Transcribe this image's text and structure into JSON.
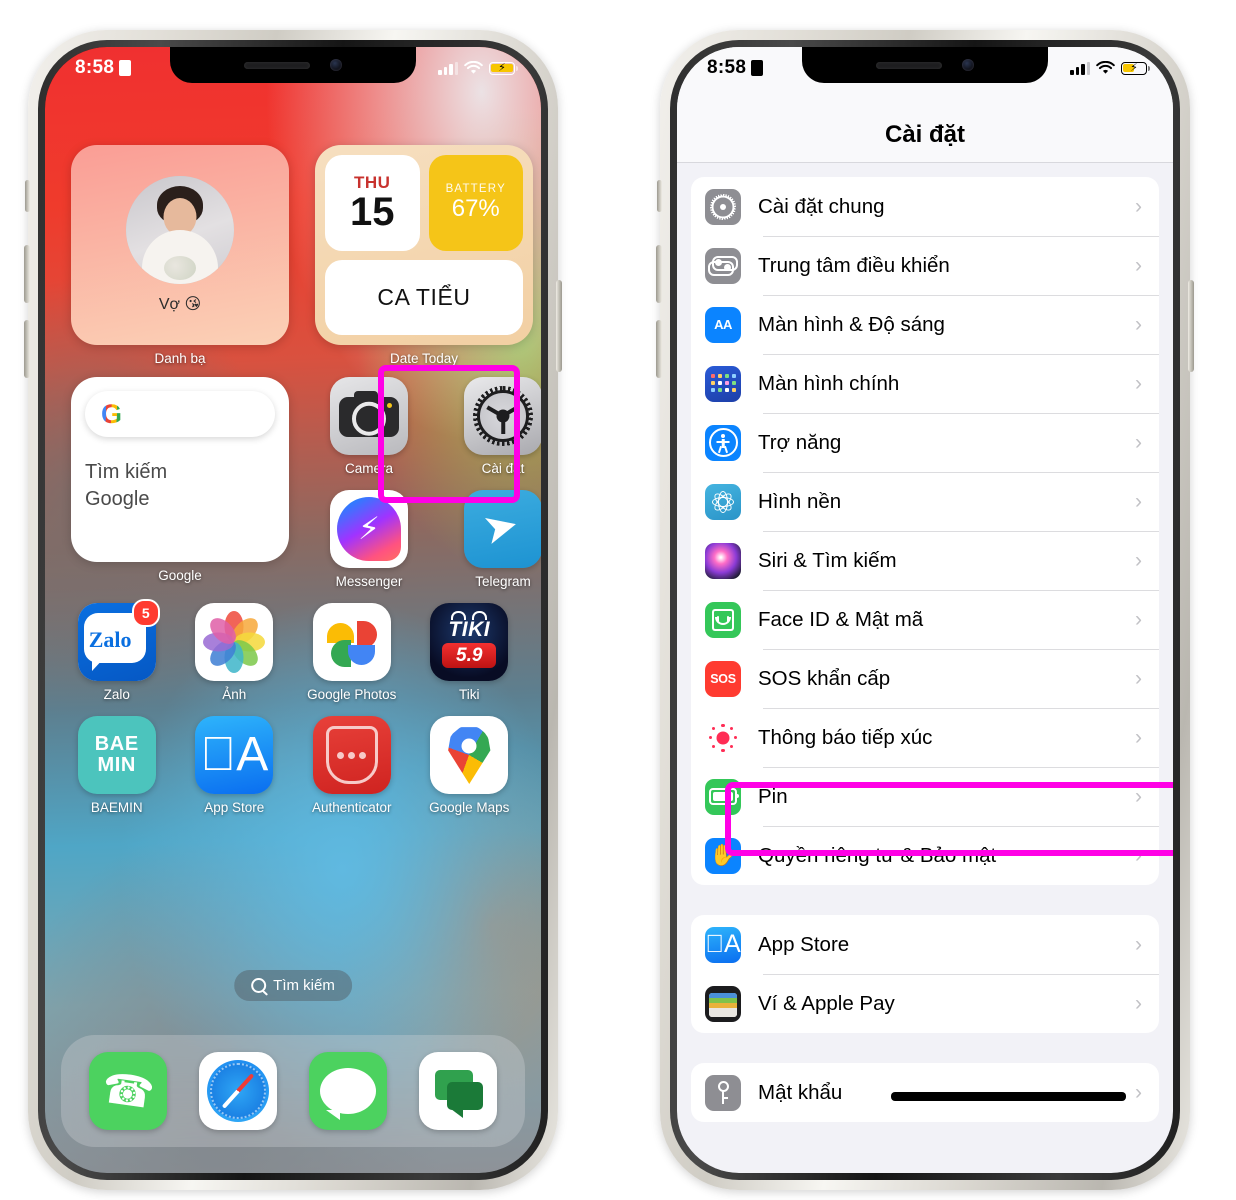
{
  "left_phone": {
    "status_bar": {
      "time": "8:58",
      "lock_icon": "orientation-lock-icon",
      "signal": "signal-bars-icon",
      "wifi": "wifi-icon",
      "battery": "battery-charging-icon"
    },
    "widgets": [
      {
        "name": "Danh bạ",
        "type": "contacts",
        "contact_name": "Vợ 😘"
      },
      {
        "name": "Date Today",
        "type": "date",
        "day_of_week": "THU",
        "day_number": "15",
        "battery_label": "BATTERY",
        "battery_value": "67%",
        "shift": "CA TIỂU"
      }
    ],
    "google_widget": {
      "label": "Google",
      "search_text": "Tìm kiếm\nGoogle",
      "line1": "Tìm kiếm",
      "line2": "Google"
    },
    "apps_row1": [
      {
        "label": "Camera",
        "icon": "camera-icon"
      },
      {
        "label": "Cài đặt",
        "icon": "settings-gear-icon",
        "highlighted": true
      }
    ],
    "apps_row2": [
      {
        "label": "Messenger",
        "icon": "messenger-icon"
      },
      {
        "label": "Telegram",
        "icon": "telegram-icon"
      }
    ],
    "apps_row3": [
      {
        "label": "Zalo",
        "icon": "zalo-icon",
        "badge": "5"
      },
      {
        "label": "Ảnh",
        "icon": "photos-icon"
      },
      {
        "label": "Google Photos",
        "icon": "google-photos-icon"
      },
      {
        "label": "Tiki",
        "icon": "tiki-icon",
        "brand": "TIKI",
        "promo": "5.9"
      }
    ],
    "apps_row4": [
      {
        "label": "BAEMIN",
        "icon": "baemin-icon",
        "line1": "BAE",
        "line2": "MIN"
      },
      {
        "label": "App Store",
        "icon": "app-store-icon"
      },
      {
        "label": "Authenticator",
        "icon": "authenticator-icon"
      },
      {
        "label": "Google Maps",
        "icon": "google-maps-icon"
      }
    ],
    "search_pill": {
      "label": "Tìm kiếm",
      "icon": "search-icon"
    },
    "dock": [
      {
        "label": "Phone",
        "icon": "phone-icon"
      },
      {
        "label": "Safari",
        "icon": "safari-icon"
      },
      {
        "label": "Messages",
        "icon": "messages-icon"
      },
      {
        "label": "Google Messages",
        "icon": "google-messages-icon"
      }
    ]
  },
  "right_phone": {
    "status_bar": {
      "time": "8:58",
      "lock_icon": "orientation-lock-icon",
      "signal": "signal-bars-icon",
      "wifi": "wifi-icon",
      "battery": "battery-charging-icon"
    },
    "nav_title": "Cài đặt",
    "groups": [
      {
        "rows": [
          {
            "label": "Cài đặt chung",
            "icon": "general-gear-icon"
          },
          {
            "label": "Trung tâm điều khiển",
            "icon": "control-center-icon"
          },
          {
            "label": "Màn hình & Độ sáng",
            "icon": "display-brightness-icon"
          },
          {
            "label": "Màn hình chính",
            "icon": "home-screen-icon"
          },
          {
            "label": "Trợ năng",
            "icon": "accessibility-icon"
          },
          {
            "label": "Hình nền",
            "icon": "wallpaper-icon"
          },
          {
            "label": "Siri & Tìm kiếm",
            "icon": "siri-icon"
          },
          {
            "label": "Face ID & Mật mã",
            "icon": "face-id-icon"
          },
          {
            "label": "SOS khẩn cấp",
            "icon": "sos-icon"
          },
          {
            "label": "Thông báo tiếp xúc",
            "icon": "exposure-notification-icon"
          },
          {
            "label": "Pin",
            "icon": "battery-icon",
            "highlighted": true
          },
          {
            "label": "Quyền riêng tư & Bảo mật",
            "icon": "privacy-hand-icon"
          }
        ]
      },
      {
        "rows": [
          {
            "label": "App Store",
            "icon": "app-store-icon"
          },
          {
            "label": "Ví & Apple Pay",
            "icon": "wallet-icon"
          }
        ]
      },
      {
        "rows": [
          {
            "label": "Mật khẩu",
            "icon": "passwords-key-icon",
            "redacted": true
          }
        ]
      }
    ]
  },
  "colors": {
    "highlight": "#ff00e6",
    "ios_blue": "#0b84ff",
    "ios_green": "#34c759",
    "ios_red": "#ff3b30",
    "ios_gray": "#8e8e93",
    "battery_yellow": "#f5c518"
  }
}
